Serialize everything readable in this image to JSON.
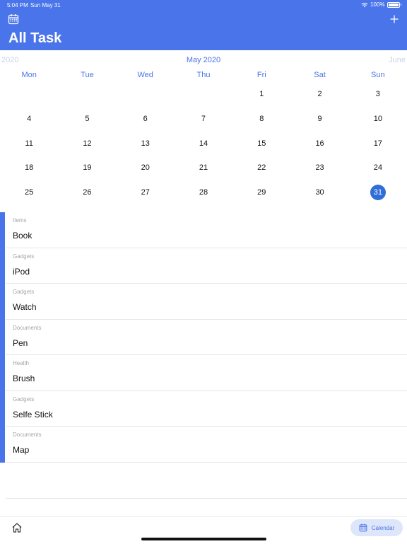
{
  "status": {
    "time": "5:04 PM",
    "date": "Sun May 31",
    "battery": "100%"
  },
  "header": {
    "title": "All Task"
  },
  "calendar": {
    "prev_month": "2020",
    "current_month": "May 2020",
    "next_month": "June",
    "weekdays": [
      "Mon",
      "Tue",
      "Wed",
      "Thu",
      "Fri",
      "Sat",
      "Sun"
    ],
    "days": [
      "",
      "",
      "",
      "",
      "1",
      "2",
      "3",
      "4",
      "5",
      "6",
      "7",
      "8",
      "9",
      "10",
      "11",
      "12",
      "13",
      "14",
      "15",
      "16",
      "17",
      "18",
      "19",
      "20",
      "21",
      "22",
      "23",
      "24",
      "25",
      "26",
      "27",
      "28",
      "29",
      "30",
      "31"
    ],
    "selected_day": "31"
  },
  "tasks": [
    {
      "category": "Items",
      "name": "Book"
    },
    {
      "category": "Gadgets",
      "name": "iPod"
    },
    {
      "category": "Gadgets",
      "name": "Watch"
    },
    {
      "category": "Documents",
      "name": "Pen"
    },
    {
      "category": "Health",
      "name": "Brush"
    },
    {
      "category": "Gadgets",
      "name": "Selfe Stick"
    },
    {
      "category": "Documents",
      "name": "Map"
    }
  ],
  "tabbar": {
    "calendar_label": "Calendar"
  },
  "colors": {
    "accent": "#4A74EA",
    "selected": "#2F6DD8"
  },
  "icons": {
    "header_left": "calendar-icon",
    "header_right": "plus-icon",
    "tab_home": "home-icon",
    "tab_calendar": "calendar-icon"
  }
}
